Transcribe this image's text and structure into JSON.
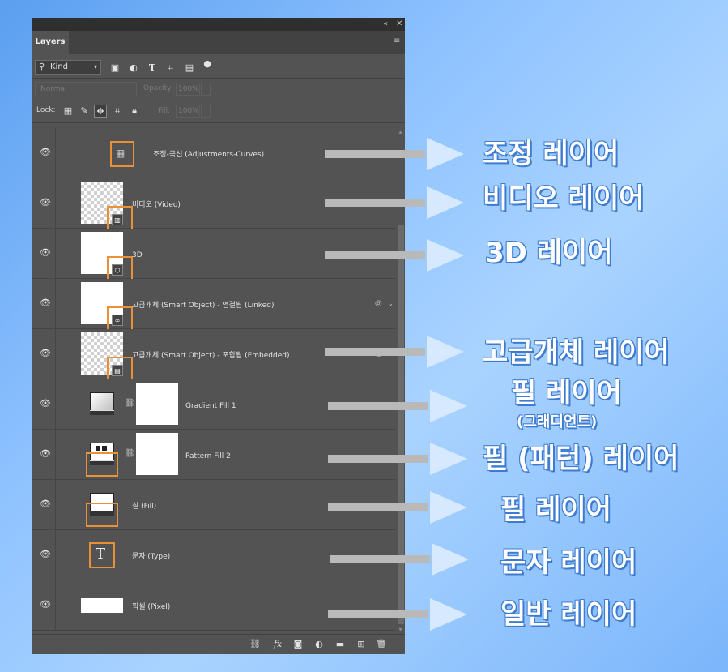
{
  "panel": {
    "collapse_icon": "«",
    "close_icon": "✕",
    "tab_label": "Layers",
    "menu_icon": "≡",
    "filter": {
      "kind_label": "Kind",
      "icons": [
        "image-filter-icon",
        "adjustment-filter-icon",
        "type-filter-icon",
        "shape-filter-icon",
        "smart-object-filter-icon",
        "filter-toggle-icon"
      ]
    },
    "blend_mode": "Normal",
    "opacity_label": "Opacity:",
    "opacity_value": "100%",
    "lock_label": "Lock:",
    "fill_label": "Fill:",
    "fill_value": "100%"
  },
  "layers": [
    {
      "name": "조정-곡선 (Adjustments-Curves)"
    },
    {
      "name": "비디오 (Video)"
    },
    {
      "name": "3D"
    },
    {
      "name": "고급개체 (Smart Object) - 연결됨 (Linked)"
    },
    {
      "name": "고급개체 (Smart Object) - 포함됨 (Embedded)"
    },
    {
      "name": "Gradient Fill 1"
    },
    {
      "name": "Pattern Fill 2"
    },
    {
      "name": "칠 (Fill)"
    },
    {
      "name": "문자 (Type)"
    },
    {
      "name": "픽셀 (Pixel)"
    }
  ],
  "bottom_icons": [
    "link-icon",
    "fx-icon",
    "mask-icon",
    "adjustment-icon",
    "folder-icon",
    "new-layer-icon",
    "trash-icon"
  ],
  "callouts": {
    "adjustment": "조정 레이어",
    "video": "비디오 레이어",
    "three_d": "3D 레이어",
    "smart_object": "고급개체 레이어",
    "fill_gradient": "필 레이어",
    "fill_gradient_sub": "(그래디언트)",
    "fill_pattern": "필 (패턴) 레이어",
    "fill": "필 레이어",
    "type": "문자 레이어",
    "pixel": "일반 레이어"
  },
  "colors": {
    "highlight_box": "#e8913a",
    "panel_bg": "#535353"
  }
}
